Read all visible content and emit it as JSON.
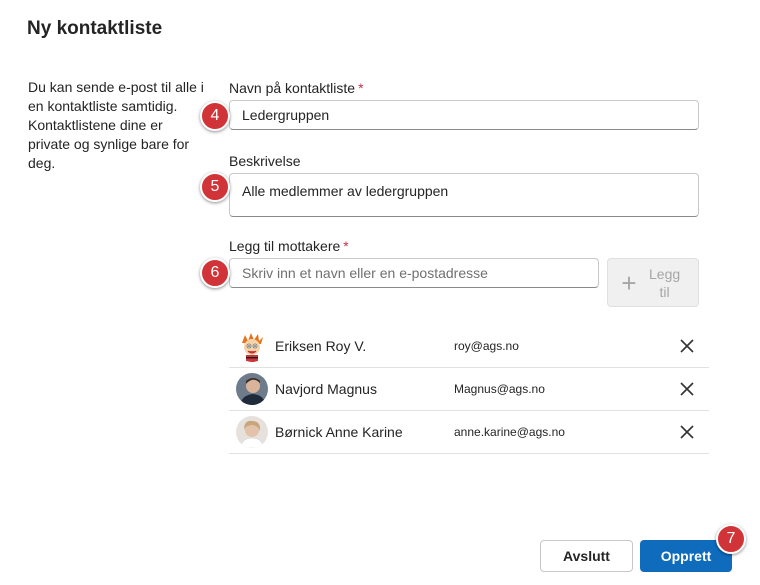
{
  "dialog": {
    "title": "Ny kontaktliste",
    "description": "Du kan sende e-post til alle i en kontaktliste samtidig. Kontaktlistene dine er private og synlige bare for deg."
  },
  "form": {
    "name_label": "Navn på kontaktliste",
    "required_mark": "*",
    "name_value": "Ledergruppen",
    "description_label": "Beskrivelse",
    "description_value": "Alle medlemmer av ledergruppen",
    "recipients_label": "Legg til mottakere",
    "recipients_placeholder": "Skriv inn et navn eller en e-postadresse",
    "add_button_label": "Legg til"
  },
  "members": [
    {
      "name": "Eriksen Roy V.",
      "email": "roy@ags.no",
      "avatar": "cartoon-avatar"
    },
    {
      "name": "Navjord Magnus",
      "email": "Magnus@ags.no",
      "avatar": "photo-avatar"
    },
    {
      "name": "Børnick Anne Karine",
      "email": "anne.karine@ags.no",
      "avatar": "photo-avatar"
    }
  ],
  "footer": {
    "cancel_label": "Avslutt",
    "create_label": "Opprett"
  },
  "badges": [
    "4",
    "5",
    "6",
    "7"
  ],
  "colors": {
    "primary": "#0f6cbd",
    "badge": "#d13438",
    "required": "#c4314b"
  }
}
